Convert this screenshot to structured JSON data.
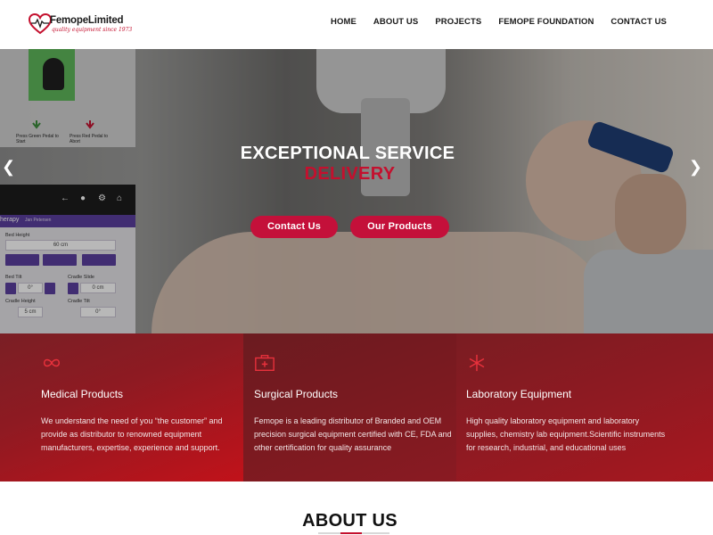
{
  "logo": {
    "name": "FemopeLimited",
    "tagline": "quality equipment since 1973"
  },
  "nav": {
    "items": [
      "HOME",
      "ABOUT US",
      "PROJECTS",
      "FEMOPE FOUNDATION",
      "CONTACT US"
    ]
  },
  "hero": {
    "title": "EXCEPTIONAL SERVICE",
    "subtitle": "DELIVERY",
    "buttons": [
      "Contact Us",
      "Our Products"
    ],
    "image_text": {
      "panel_label_1": "Press Green Pedal to Start",
      "panel_label_2": "Press Red Pedal to Abort",
      "screen_tab": "herapy",
      "screen_user": "Jan Petersen",
      "bed_height_label": "Bed Height",
      "bed_height_value": "60 cm",
      "bed_tilt_label": "Bed Tilt",
      "bed_tilt_value": "0°",
      "cradle_slide_label": "Cradle Slide",
      "cradle_slide_value": "0 cm",
      "cradle_height_label": "Cradle Height",
      "cradle_height_value": "5 cm",
      "cradle_tilt_label": "Cradle Tilt",
      "cradle_tilt_value": "0°"
    }
  },
  "features": [
    {
      "icon": "infinity-icon",
      "title": "Medical Products",
      "description": "We understand the need of you “the customer” and provide as distributor to renowned equipment manufacturers, expertise, experience and support."
    },
    {
      "icon": "medical-kit-icon",
      "title": "Surgical Products",
      "description": "Femope is a leading distributor of Branded and OEM precision surgical equipment certified with CE, FDA and other certification for quality assurance"
    },
    {
      "icon": "asterisk-icon",
      "title": "Laboratory Equipment",
      "description": "High quality laboratory equipment and laboratory supplies, chemistry lab equipment.Scientific instruments for research, industrial, and educational uses"
    }
  ],
  "about": {
    "title": "ABOUT US"
  },
  "colors": {
    "accent": "#c4102e",
    "button": "#c4103a",
    "feature_dark": "#7a1a20"
  }
}
